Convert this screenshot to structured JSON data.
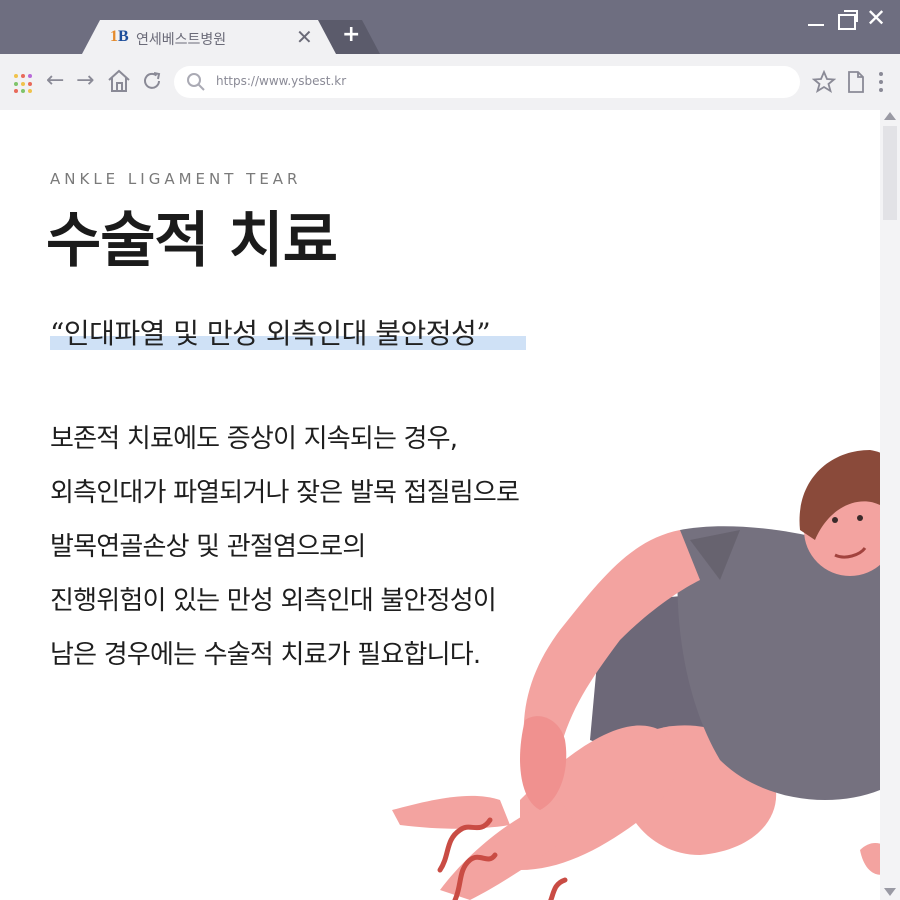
{
  "browser": {
    "tab": {
      "logo": "B",
      "logo_prefix": "1",
      "title": "연세베스트병원",
      "close": "✕"
    },
    "new_tab": "+",
    "window_controls": {
      "close": "✕"
    },
    "nav": {
      "back": "←",
      "forward": "→",
      "home": "⌂",
      "reload": "↻"
    },
    "url": "https://www.ysbest.kr",
    "icons": [
      "apps-icon",
      "back-icon",
      "forward-icon",
      "home-icon",
      "reload-icon",
      "search-icon",
      "star-icon",
      "page-icon",
      "menu-icon"
    ],
    "colors": {
      "chrome": "#6e6e80",
      "toolbar": "#f1f1f3",
      "highlight": "#cfe1f6"
    }
  },
  "content": {
    "eyebrow": "ANKLE LIGAMENT TEAR",
    "title": "수술적 치료",
    "quote": "“인대파열 및 만성 외측인대 불안정성”",
    "body": [
      "보존적 치료에도 증상이 지속되는 경우,",
      "외측인대가 파열되거나 잦은 발목 접질림으로",
      "발목연골손상 및 관절염으로의",
      "진행위험이 있는 만성 외측인대 불안정성이",
      "남은 경우에는 수술적 치료가 필요합니다."
    ],
    "illustration": "man-holding-injured-ankle"
  }
}
